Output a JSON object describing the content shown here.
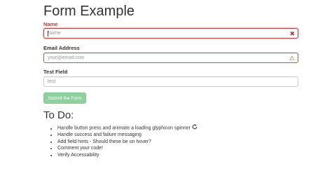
{
  "form": {
    "title": "Form Example",
    "fields": [
      {
        "label": "Name",
        "placeholder": "Name",
        "value": "",
        "state": "error",
        "icon": "remove-icon",
        "icon_glyph": "✖"
      },
      {
        "label": "Email Address",
        "placeholder": "your@email.com",
        "value": "",
        "state": "warning",
        "icon": "warning-icon",
        "icon_glyph": "⚠"
      },
      {
        "label": "Test Field",
        "placeholder": "test",
        "value": "",
        "state": "default"
      }
    ],
    "submit_label": "Submit the Form"
  },
  "todo": {
    "title": "To Do:",
    "items": [
      "Handle button press and animate a loading glyphicon spinner",
      "Handle success and failure messaging",
      "Add field hints - Should these be on hover?",
      "Comment your code!",
      "Verify Accessability"
    ]
  },
  "colors": {
    "error": "#a94442",
    "warning": "#8a6d3b",
    "submit_button": "#8fd19e"
  }
}
